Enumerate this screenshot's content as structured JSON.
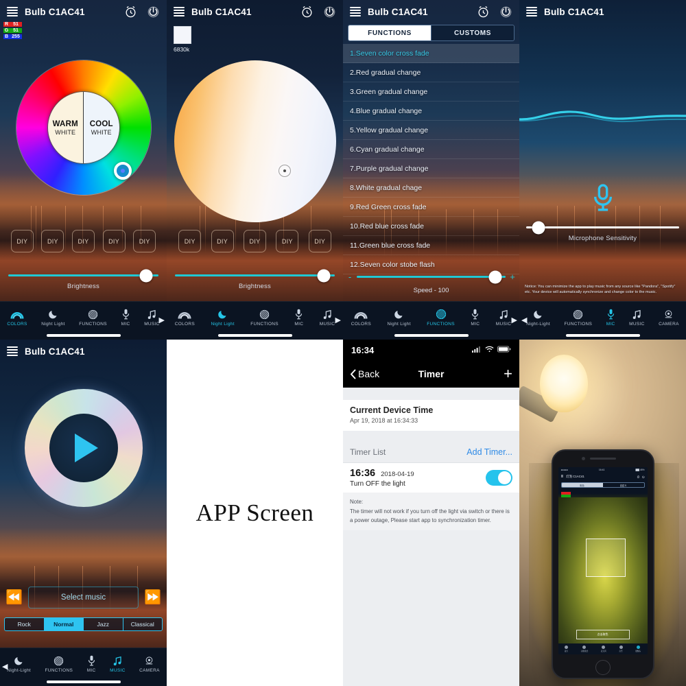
{
  "app": {
    "device_name": "Bulb C1AC41",
    "icons": {
      "menu": "menu-icon",
      "alarm": "alarm-clock-icon",
      "power": "power-icon"
    }
  },
  "nav": {
    "items_a": [
      {
        "label": "COLORS",
        "icon": "rainbow-arc-icon",
        "active": true
      },
      {
        "label": "Night Light",
        "icon": "moon-icon",
        "active": false
      },
      {
        "label": "FUNCTIONS",
        "icon": "hatched-circle-icon",
        "active": false
      },
      {
        "label": "MIC",
        "icon": "microphone-icon",
        "active": false
      },
      {
        "label": "MUSIC",
        "icon": "music-note-icon",
        "active": false
      }
    ],
    "items_b": [
      {
        "label": "COLORS",
        "icon": "rainbow-arc-icon",
        "active": false
      },
      {
        "label": "Night Light",
        "icon": "moon-icon",
        "active": true
      },
      {
        "label": "FUNCTIONS",
        "icon": "hatched-circle-icon",
        "active": false
      },
      {
        "label": "MIC",
        "icon": "microphone-icon",
        "active": false
      },
      {
        "label": "MUSIC",
        "icon": "music-note-icon",
        "active": false
      }
    ],
    "items_c": [
      {
        "label": "COLORS",
        "icon": "rainbow-arc-icon",
        "active": false
      },
      {
        "label": "Night Light",
        "icon": "moon-icon",
        "active": false
      },
      {
        "label": "FUNCTIONS",
        "icon": "hatched-circle-icon",
        "active": true
      },
      {
        "label": "MIC",
        "icon": "microphone-icon",
        "active": false
      },
      {
        "label": "MUSIC",
        "icon": "music-note-icon",
        "active": false
      }
    ],
    "items_d": [
      {
        "label": "Night-Light",
        "icon": "moon-icon",
        "active": false
      },
      {
        "label": "FUNCTIONS",
        "icon": "hatched-circle-icon",
        "active": false
      },
      {
        "label": "MIC",
        "icon": "microphone-icon",
        "active": true
      },
      {
        "label": "MUSIC",
        "icon": "music-note-icon",
        "active": false
      },
      {
        "label": "CAMERA",
        "icon": "camera-icon",
        "active": false
      }
    ],
    "items_e": [
      {
        "label": "Night-Light",
        "icon": "moon-icon",
        "active": false
      },
      {
        "label": "FUNCTIONS",
        "icon": "hatched-circle-icon",
        "active": false
      },
      {
        "label": "MIC",
        "icon": "microphone-icon",
        "active": false
      },
      {
        "label": "MUSIC",
        "icon": "music-note-icon",
        "active": true
      },
      {
        "label": "CAMERA",
        "icon": "camera-icon",
        "active": false
      }
    ]
  },
  "colors_screen": {
    "rgb": {
      "r_key": "R",
      "r_value": "51",
      "g_key": "G",
      "g_value": "51",
      "b_key": "B",
      "b_value": "255"
    },
    "wheel": {
      "warm_line1": "WARM",
      "warm_line2": "WHITE",
      "cool_line1": "COOL",
      "cool_line2": "WHITE"
    },
    "diy": [
      "DIY",
      "DIY",
      "DIY",
      "DIY",
      "DIY"
    ],
    "brightness_label": "Brightness",
    "brightness_percent": 92
  },
  "nightlight_screen": {
    "cct_label": "6830k",
    "diy": [
      "DIY",
      "DIY",
      "DIY",
      "DIY",
      "DIY"
    ],
    "brightness_label": "Brightness",
    "brightness_percent": 94
  },
  "functions_screen": {
    "tabs": [
      {
        "label": "FUNCTIONS",
        "active": true
      },
      {
        "label": "CUSTOMS",
        "active": false
      }
    ],
    "list": [
      "1.Seven color cross fade",
      "2.Red gradual change",
      "3.Green gradual change",
      "4.Blue gradual change",
      "5.Yellow gradual change",
      "6.Cyan gradual change",
      "7.Purple gradual change",
      "8.White gradual chage",
      "9.Red Green cross fade",
      "10.Red blue cross fade",
      "11.Green blue cross fade",
      "12.Seven color stobe flash"
    ],
    "selected_index": 0,
    "speed_minus": "-",
    "speed_plus": "+",
    "speed_label": "Speed - 100",
    "speed_percent": 93
  },
  "mic_screen": {
    "sensitivity_label": "Microphone Sensitivity",
    "sensitivity_percent": 8,
    "notice": "Notice: You can minimize the app to play music from any source like \"Pandora\", \"Spotify\" etc. Your device will automatically synchronize and change color to the music."
  },
  "music_screen": {
    "select_music_label": "Select music",
    "prev_icon": "rewind-icon",
    "next_icon": "fast-forward-icon",
    "genres": [
      {
        "label": "Rock",
        "active": false
      },
      {
        "label": "Normal",
        "active": true
      },
      {
        "label": "Jazz",
        "active": false
      },
      {
        "label": "Classical",
        "active": false
      }
    ]
  },
  "app_screen_caption": "APP Screen",
  "timer_screen": {
    "status_time": "16:34",
    "status_icons": [
      "signal-bars-icon",
      "wifi-icon",
      "battery-icon"
    ],
    "back_label": "Back",
    "title": "Timer",
    "add_icon": "plus-icon",
    "current_time_heading": "Current Device Time",
    "current_time_value": "Apr 19, 2018 at 16:34:33",
    "list_heading": "Timer List",
    "add_timer_label": "Add Timer...",
    "entry": {
      "time": "16:36",
      "date": "2018-04-19",
      "action": "Turn OFF the light",
      "enabled": true
    },
    "note_heading": "Note:",
    "note_body": "The timer will not work if you turn off the light via switch or there is a power outage, Please start app to synchronization timer."
  },
  "photo_panel": {
    "phone_title": "灯泡 C1AC41",
    "phone_tabs": [
      {
        "label": "取色",
        "active": true
      },
      {
        "label": "自定义",
        "active": false
      }
    ],
    "phone_button": "点击取色",
    "phone_nav": [
      {
        "label": "夜灯",
        "active": false
      },
      {
        "label": "功能模式",
        "active": false
      },
      {
        "label": "麦克风",
        "active": false
      },
      {
        "label": "音乐",
        "active": false
      },
      {
        "label": "摄像头",
        "active": true
      }
    ]
  },
  "colors": {
    "accent": "#25c6e8",
    "slider_track": "#1fc8d4",
    "toggle_on": "#25c3ec",
    "link": "#2e8ae6"
  }
}
